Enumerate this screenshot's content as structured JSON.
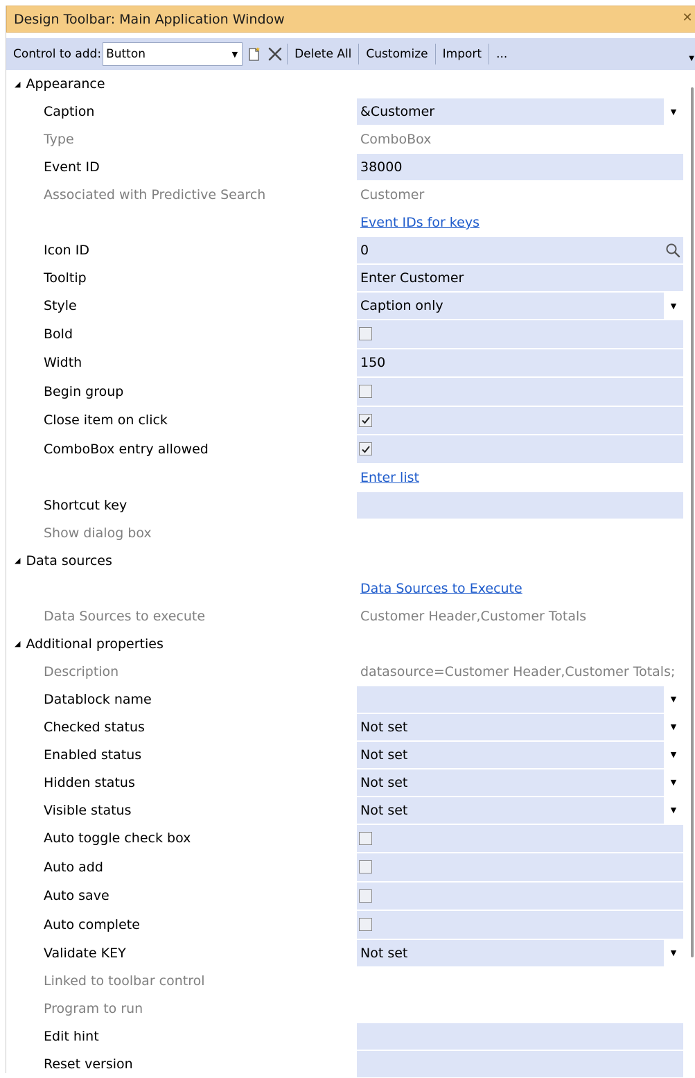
{
  "window": {
    "title": "Design Toolbar: Main Application Window"
  },
  "toolbar": {
    "control_label": "Control to add:",
    "control_value": "Button",
    "delete_all": "Delete All",
    "customize": "Customize",
    "import": "Import",
    "more": "..."
  },
  "appearance": {
    "header": "Appearance",
    "caption_label": "Caption",
    "caption_value": "&Customer",
    "type_label": "Type",
    "type_value": "ComboBox",
    "event_id_label": "Event ID",
    "event_id_value": "38000",
    "predictive_label": "Associated with Predictive Search",
    "predictive_value": "Customer",
    "event_keys_link": "Event IDs for keys",
    "icon_id_label": "Icon ID",
    "icon_id_value": "0",
    "tooltip_label": "Tooltip",
    "tooltip_value": "Enter Customer",
    "style_label": "Style",
    "style_value": "Caption only",
    "bold_label": "Bold",
    "bold_checked": false,
    "width_label": "Width",
    "width_value": "150",
    "begin_group_label": "Begin group",
    "begin_group_checked": false,
    "close_item_label": "Close item on click",
    "close_item_checked": true,
    "combo_entry_label": "ComboBox entry allowed",
    "combo_entry_checked": true,
    "enter_list_link": "Enter list",
    "shortcut_label": "Shortcut key",
    "shortcut_value": "",
    "show_dialog_label": "Show dialog box"
  },
  "data_sources": {
    "header": "Data sources",
    "execute_link": "Data Sources to Execute",
    "execute_label": "Data Sources to execute",
    "execute_value": "Customer Header,Customer Totals"
  },
  "additional": {
    "header": "Additional properties",
    "description_label": "Description",
    "description_value": "datasource=Customer Header,Customer Totals;",
    "datablock_label": "Datablock name",
    "datablock_value": "",
    "checked_status_label": "Checked status",
    "checked_status_value": "Not set",
    "enabled_status_label": "Enabled status",
    "enabled_status_value": "Not set",
    "hidden_status_label": "Hidden status",
    "hidden_status_value": "Not set",
    "visible_status_label": "Visible status",
    "visible_status_value": "Not set",
    "auto_toggle_label": "Auto toggle check box",
    "auto_toggle_checked": false,
    "auto_add_label": "Auto add",
    "auto_add_checked": false,
    "auto_save_label": "Auto save",
    "auto_save_checked": false,
    "auto_complete_label": "Auto complete",
    "auto_complete_checked": false,
    "validate_key_label": "Validate KEY",
    "validate_key_value": "Not set",
    "linked_label": "Linked to toolbar control",
    "program_label": "Program to run",
    "edit_hint_label": "Edit hint",
    "edit_hint_value": "",
    "reset_version_label": "Reset version",
    "reset_version_value": ""
  },
  "colors": {
    "title_bar": "#f5cc84",
    "toolbar": "#d4dcf2",
    "field": "#dde4f7",
    "link": "#1f5ccc",
    "disabled_text": "#808080"
  }
}
